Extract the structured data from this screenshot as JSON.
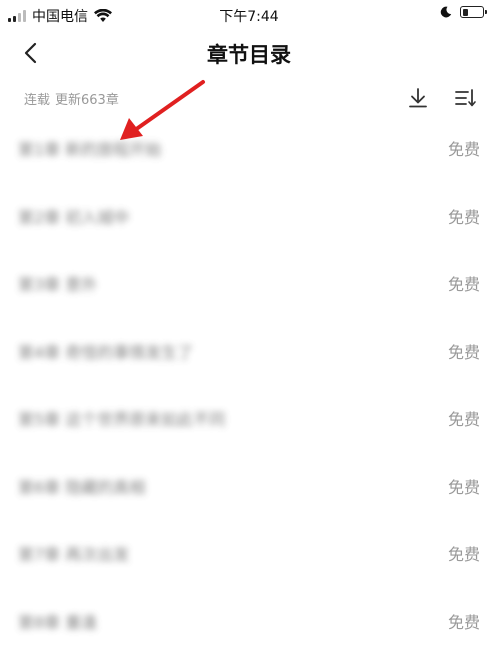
{
  "status_bar": {
    "carrier": "中国电信",
    "time": "下午7:44",
    "battery_level": 0.3
  },
  "header": {
    "back_icon": "chevron-left-icon",
    "title": "章节目录"
  },
  "info_bar": {
    "status": "连载",
    "update_text": "更新663章",
    "download_icon": "download-icon",
    "sort_icon": "sort-icon"
  },
  "chapters": [
    {
      "title": "第1章 新的旅程开始",
      "badge": "免费"
    },
    {
      "title": "第2章 初入城中",
      "badge": "免费"
    },
    {
      "title": "第3章 意外",
      "badge": "免费"
    },
    {
      "title": "第4章 奇怪的事情发生了",
      "badge": "免费"
    },
    {
      "title": "第5章 这个世界原来如此不同",
      "badge": "免费"
    },
    {
      "title": "第6章 隐藏的真相",
      "badge": "免费"
    },
    {
      "title": "第7章 再次出发",
      "badge": "免费"
    },
    {
      "title": "第8章 重逢",
      "badge": "免费"
    }
  ],
  "annotation": {
    "color": "#e02020"
  }
}
